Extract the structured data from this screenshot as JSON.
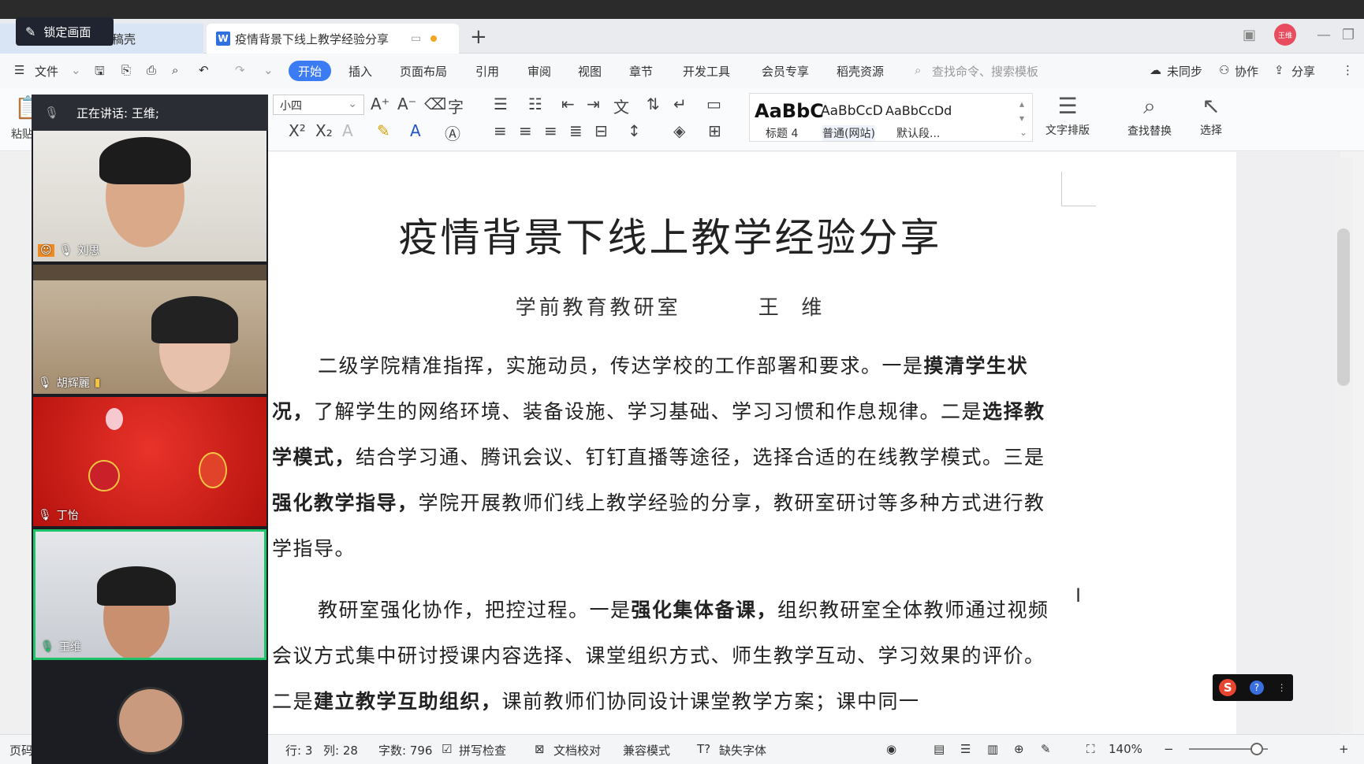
{
  "lock_screen": {
    "label": "锁定画面"
  },
  "tabs": [
    {
      "label": "稿壳"
    },
    {
      "label": "疫情背景下线上教学经验分享"
    }
  ],
  "avatar_text": "王维",
  "menu": {
    "file": "文件",
    "items": [
      "开始",
      "插入",
      "页面布局",
      "引用",
      "审阅",
      "视图",
      "章节",
      "开发工具",
      "会员专享",
      "稻壳资源"
    ],
    "search_placeholder": "查找命令、搜索模板",
    "right": [
      "未同步",
      "协作",
      "分享"
    ]
  },
  "ribbon": {
    "paste": "粘贴",
    "font_size": "小四",
    "styles": [
      {
        "sample": "AaBbC",
        "label": "标题 4"
      },
      {
        "sample": "AaBbCcD",
        "label": "普通(网站)"
      },
      {
        "sample": "AaBbCcDd",
        "label": "默认段..."
      }
    ],
    "text_layout": "文字排版",
    "find_replace": "查找替换",
    "select": "选择"
  },
  "document": {
    "title": "疫情背景下线上教学经验分享",
    "subtitle": "学前教育教研室        王  维",
    "para1": [
      {
        "t": "二级学院精准指挥，实施动员，传达学校的工作部署和要求。一是",
        "b": false
      },
      {
        "t": "摸清学生状况，",
        "b": true
      },
      {
        "t": "了解学生的网络环境、装备设施、学习基础、学习习惯和作息规律。二是",
        "b": false
      },
      {
        "t": "选择教学模式，",
        "b": true
      },
      {
        "t": "结合学习通、腾讯会议、钉钉直播等途径，选择合适的在线教学模式。三是",
        "b": false
      },
      {
        "t": "强化教学指导，",
        "b": true
      },
      {
        "t": "学院开展教师们线上教学经验的分享，教研室研讨等多种方式进行教学指导。",
        "b": false
      }
    ],
    "para2": [
      {
        "t": "教研室强化协作，把控过程。一是",
        "b": false
      },
      {
        "t": "强化集体备课，",
        "b": true
      },
      {
        "t": "组织教研室全体教师通过视频会议方式集中研讨授课内容选择、课堂组织方式、师生教学互动、学习效果的评价。二是",
        "b": false
      },
      {
        "t": "建立教学互助组织，",
        "b": true
      },
      {
        "t": "课前教师们协同设计课堂教学方案；课中同一",
        "b": false
      }
    ]
  },
  "statusbar": {
    "page": "页码",
    "row": "行: 3",
    "col": "列: 28",
    "words": "字数: 796",
    "spell": "拼写检查",
    "proof": "文档校对",
    "compat": "兼容模式",
    "missing_font": "缺失字体",
    "zoom": "140%",
    "zoom_level": 0.86
  },
  "meeting": {
    "speaking": "正在讲话: 王维;",
    "participants": [
      {
        "name": "刘思"
      },
      {
        "name": "胡辉麗"
      },
      {
        "name": "丁怡"
      },
      {
        "name": "王维"
      }
    ]
  },
  "colors": {
    "accent": "#3b7cf5",
    "active_speaker": "#1fc46a"
  }
}
